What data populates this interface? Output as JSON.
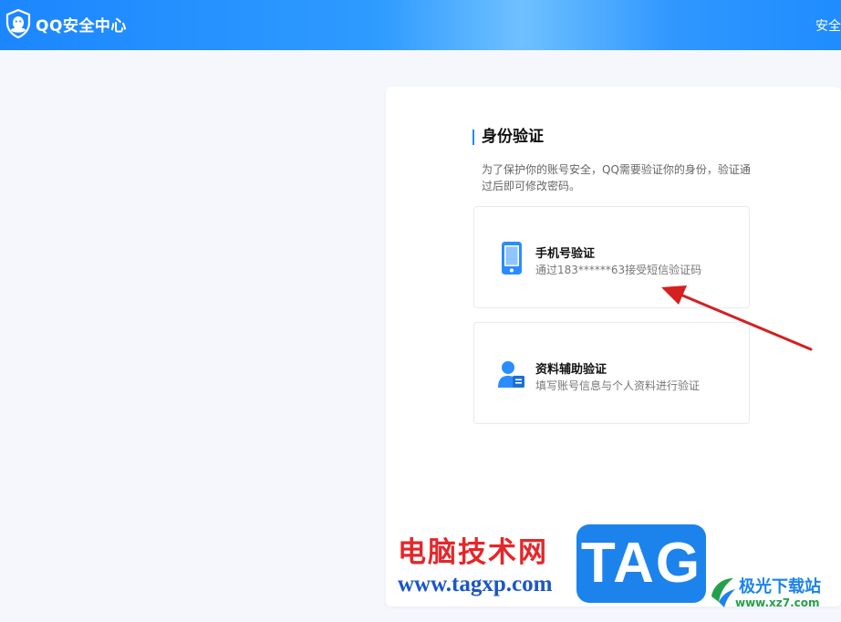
{
  "header": {
    "logo_text": "QQ安全中心",
    "right_link": "安全"
  },
  "verify": {
    "title": "身份验证",
    "description": "为了保护你的账号安全，QQ需要验证你的身份，验证通过后即可修改密码。",
    "options": [
      {
        "title": "手机号验证",
        "subtitle": "通过183******63接受短信验证码",
        "icon": "phone-icon"
      },
      {
        "title": "资料辅助验证",
        "subtitle": "填写账号信息与个人资料进行验证",
        "icon": "user-card-icon"
      }
    ]
  },
  "watermark": {
    "site_cn": "电脑技术网",
    "site_url": "www.tagxp.com",
    "tag": "TAG",
    "jiguang_cn": "极光下载站",
    "jiguang_url": "www.xz7.com"
  },
  "colors": {
    "accent": "#1f8aff",
    "annotation_arrow": "#d42020"
  }
}
